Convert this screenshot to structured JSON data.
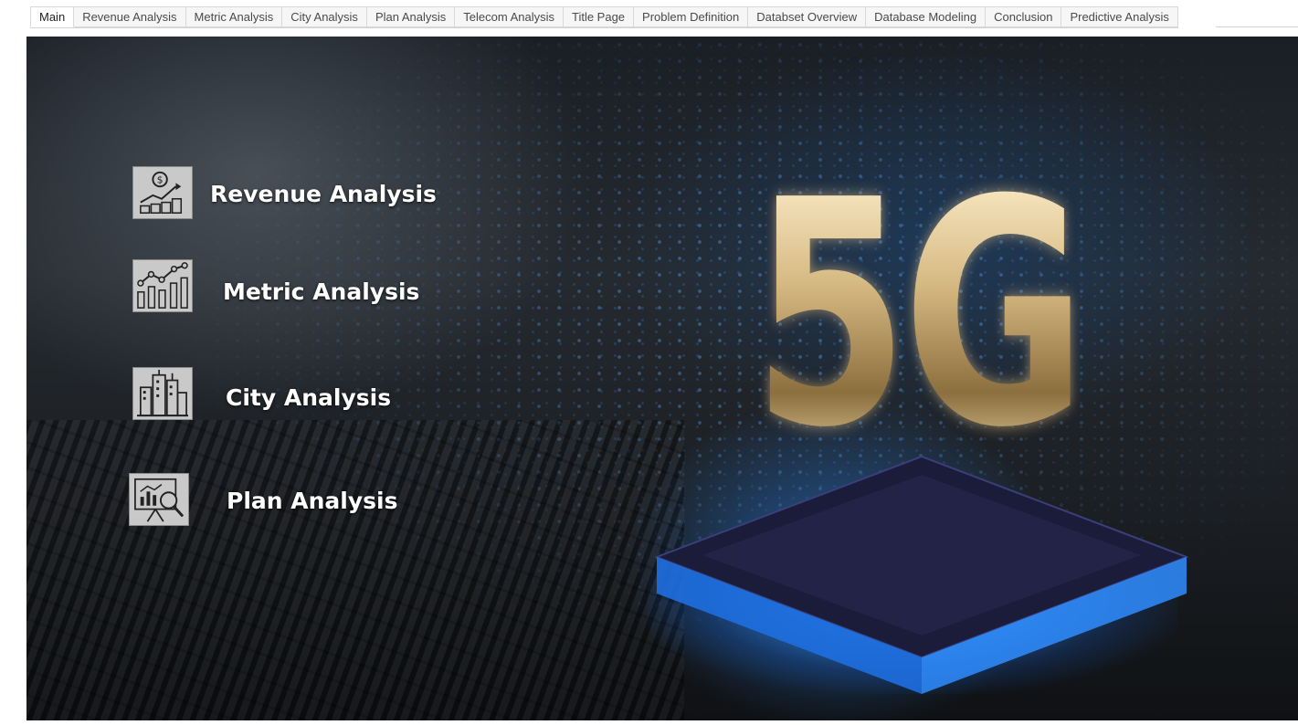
{
  "tabs": [
    {
      "label": "Main",
      "active": true
    },
    {
      "label": "Revenue Analysis",
      "active": false
    },
    {
      "label": "Metric Analysis",
      "active": false
    },
    {
      "label": "City Analysis",
      "active": false
    },
    {
      "label": "Plan Analysis",
      "active": false
    },
    {
      "label": "Telecom Analysis",
      "active": false
    },
    {
      "label": "Title Page",
      "active": false
    },
    {
      "label": "Problem Definition",
      "active": false
    },
    {
      "label": "Databset Overview",
      "active": false
    },
    {
      "label": "Database Modeling",
      "active": false
    },
    {
      "label": "Conclusion",
      "active": false
    },
    {
      "label": "Predictive Analysis",
      "active": false
    }
  ],
  "dashboard": {
    "hero_text": "5G",
    "menu": [
      {
        "label": "Revenue Analysis",
        "icon": "revenue-growth-icon"
      },
      {
        "label": "Metric Analysis",
        "icon": "line-bar-chart-icon"
      },
      {
        "label": "City Analysis",
        "icon": "city-buildings-icon"
      },
      {
        "label": "Plan Analysis",
        "icon": "presentation-analysis-icon"
      }
    ]
  },
  "colors": {
    "tab_background": "#f6f6f6",
    "tab_active": "#ffffff",
    "label_text": "#ffffff",
    "icon_tile": "#c9c9c9",
    "hero_gold": "#d9c18f",
    "chip_glow": "#3ca0ff"
  }
}
